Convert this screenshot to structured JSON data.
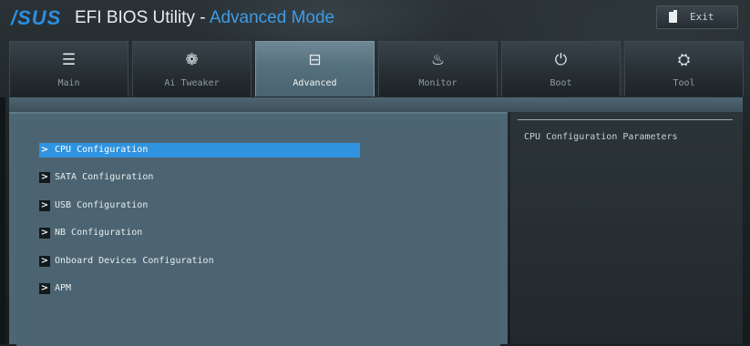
{
  "header": {
    "brand": "/SUS",
    "title_prefix": "EFI BIOS Utility - ",
    "title_mode": "Advanced Mode",
    "exit_label": "Exit",
    "exit_icon": "exit-door-icon"
  },
  "tabs": [
    {
      "label": "Main",
      "icon": "☰",
      "icon_name": "list-icon",
      "active": false
    },
    {
      "label": "Ai Tweaker",
      "icon": "❁",
      "icon_name": "fan-icon",
      "active": false
    },
    {
      "label": "Advanced",
      "icon": "⊟",
      "icon_name": "advanced-info-icon",
      "active": true
    },
    {
      "label": "Monitor",
      "icon": "♨",
      "icon_name": "monitor-gauge-icon",
      "active": false
    },
    {
      "label": "Boot",
      "icon": "⏻",
      "icon_name": "power-icon",
      "active": false
    },
    {
      "label": "Tool",
      "icon": "⛭",
      "icon_name": "toolbox-icon",
      "active": false
    }
  ],
  "menu": {
    "items": [
      {
        "label": "CPU Configuration",
        "selected": true
      },
      {
        "label": "SATA Configuration",
        "selected": false
      },
      {
        "label": "USB Configuration",
        "selected": false
      },
      {
        "label": "NB Configuration",
        "selected": false
      },
      {
        "label": "Onboard Devices Configuration",
        "selected": false
      },
      {
        "label": "APM",
        "selected": false
      }
    ],
    "arrow_glyph": ">"
  },
  "help": {
    "text": "CPU Configuration Parameters"
  },
  "colors": {
    "accent": "#2f93df",
    "panel": "#4c6471",
    "active_tab": "#5f7a87"
  }
}
